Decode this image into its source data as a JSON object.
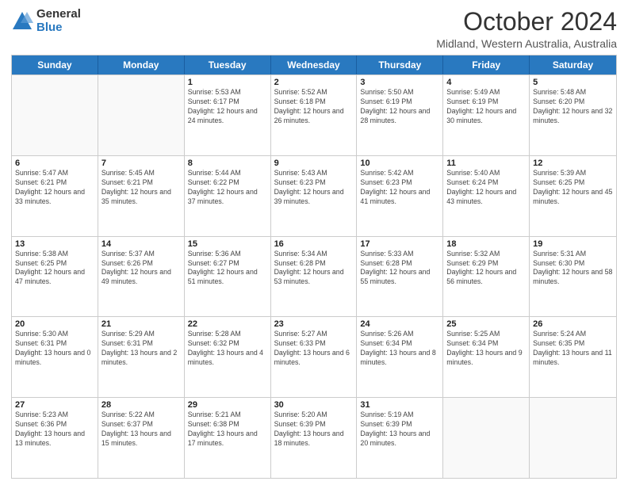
{
  "logo": {
    "general": "General",
    "blue": "Blue"
  },
  "title": "October 2024",
  "subtitle": "Midland, Western Australia, Australia",
  "days": [
    "Sunday",
    "Monday",
    "Tuesday",
    "Wednesday",
    "Thursday",
    "Friday",
    "Saturday"
  ],
  "weeks": [
    [
      {
        "date": "",
        "info": ""
      },
      {
        "date": "",
        "info": ""
      },
      {
        "date": "1",
        "info": "Sunrise: 5:53 AM\nSunset: 6:17 PM\nDaylight: 12 hours and 24 minutes."
      },
      {
        "date": "2",
        "info": "Sunrise: 5:52 AM\nSunset: 6:18 PM\nDaylight: 12 hours and 26 minutes."
      },
      {
        "date": "3",
        "info": "Sunrise: 5:50 AM\nSunset: 6:19 PM\nDaylight: 12 hours and 28 minutes."
      },
      {
        "date": "4",
        "info": "Sunrise: 5:49 AM\nSunset: 6:19 PM\nDaylight: 12 hours and 30 minutes."
      },
      {
        "date": "5",
        "info": "Sunrise: 5:48 AM\nSunset: 6:20 PM\nDaylight: 12 hours and 32 minutes."
      }
    ],
    [
      {
        "date": "6",
        "info": "Sunrise: 5:47 AM\nSunset: 6:21 PM\nDaylight: 12 hours and 33 minutes."
      },
      {
        "date": "7",
        "info": "Sunrise: 5:45 AM\nSunset: 6:21 PM\nDaylight: 12 hours and 35 minutes."
      },
      {
        "date": "8",
        "info": "Sunrise: 5:44 AM\nSunset: 6:22 PM\nDaylight: 12 hours and 37 minutes."
      },
      {
        "date": "9",
        "info": "Sunrise: 5:43 AM\nSunset: 6:23 PM\nDaylight: 12 hours and 39 minutes."
      },
      {
        "date": "10",
        "info": "Sunrise: 5:42 AM\nSunset: 6:23 PM\nDaylight: 12 hours and 41 minutes."
      },
      {
        "date": "11",
        "info": "Sunrise: 5:40 AM\nSunset: 6:24 PM\nDaylight: 12 hours and 43 minutes."
      },
      {
        "date": "12",
        "info": "Sunrise: 5:39 AM\nSunset: 6:25 PM\nDaylight: 12 hours and 45 minutes."
      }
    ],
    [
      {
        "date": "13",
        "info": "Sunrise: 5:38 AM\nSunset: 6:25 PM\nDaylight: 12 hours and 47 minutes."
      },
      {
        "date": "14",
        "info": "Sunrise: 5:37 AM\nSunset: 6:26 PM\nDaylight: 12 hours and 49 minutes."
      },
      {
        "date": "15",
        "info": "Sunrise: 5:36 AM\nSunset: 6:27 PM\nDaylight: 12 hours and 51 minutes."
      },
      {
        "date": "16",
        "info": "Sunrise: 5:34 AM\nSunset: 6:28 PM\nDaylight: 12 hours and 53 minutes."
      },
      {
        "date": "17",
        "info": "Sunrise: 5:33 AM\nSunset: 6:28 PM\nDaylight: 12 hours and 55 minutes."
      },
      {
        "date": "18",
        "info": "Sunrise: 5:32 AM\nSunset: 6:29 PM\nDaylight: 12 hours and 56 minutes."
      },
      {
        "date": "19",
        "info": "Sunrise: 5:31 AM\nSunset: 6:30 PM\nDaylight: 12 hours and 58 minutes."
      }
    ],
    [
      {
        "date": "20",
        "info": "Sunrise: 5:30 AM\nSunset: 6:31 PM\nDaylight: 13 hours and 0 minutes."
      },
      {
        "date": "21",
        "info": "Sunrise: 5:29 AM\nSunset: 6:31 PM\nDaylight: 13 hours and 2 minutes."
      },
      {
        "date": "22",
        "info": "Sunrise: 5:28 AM\nSunset: 6:32 PM\nDaylight: 13 hours and 4 minutes."
      },
      {
        "date": "23",
        "info": "Sunrise: 5:27 AM\nSunset: 6:33 PM\nDaylight: 13 hours and 6 minutes."
      },
      {
        "date": "24",
        "info": "Sunrise: 5:26 AM\nSunset: 6:34 PM\nDaylight: 13 hours and 8 minutes."
      },
      {
        "date": "25",
        "info": "Sunrise: 5:25 AM\nSunset: 6:34 PM\nDaylight: 13 hours and 9 minutes."
      },
      {
        "date": "26",
        "info": "Sunrise: 5:24 AM\nSunset: 6:35 PM\nDaylight: 13 hours and 11 minutes."
      }
    ],
    [
      {
        "date": "27",
        "info": "Sunrise: 5:23 AM\nSunset: 6:36 PM\nDaylight: 13 hours and 13 minutes."
      },
      {
        "date": "28",
        "info": "Sunrise: 5:22 AM\nSunset: 6:37 PM\nDaylight: 13 hours and 15 minutes."
      },
      {
        "date": "29",
        "info": "Sunrise: 5:21 AM\nSunset: 6:38 PM\nDaylight: 13 hours and 17 minutes."
      },
      {
        "date": "30",
        "info": "Sunrise: 5:20 AM\nSunset: 6:39 PM\nDaylight: 13 hours and 18 minutes."
      },
      {
        "date": "31",
        "info": "Sunrise: 5:19 AM\nSunset: 6:39 PM\nDaylight: 13 hours and 20 minutes."
      },
      {
        "date": "",
        "info": ""
      },
      {
        "date": "",
        "info": ""
      }
    ]
  ]
}
